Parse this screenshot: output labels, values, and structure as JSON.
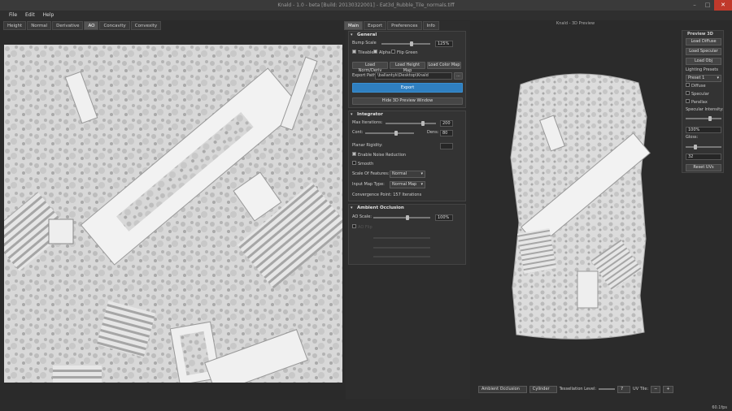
{
  "window": {
    "title": "Knald - 1.0 - beta [Build: 20130322001] - Eat3d_Rubble_Tile_normals.tiff",
    "buttons": [
      "–",
      "□",
      "✕"
    ]
  },
  "menu": [
    "File",
    "Edit",
    "Help"
  ],
  "view_tabs": [
    {
      "label": "Height",
      "active": false
    },
    {
      "label": "Normal",
      "active": false
    },
    {
      "label": "Derivative",
      "active": false
    },
    {
      "label": "AO",
      "active": true
    },
    {
      "label": "Concavity",
      "active": false
    },
    {
      "label": "Convexity",
      "active": false
    }
  ],
  "panel_tabs": [
    {
      "label": "Main",
      "active": true
    },
    {
      "label": "Export",
      "active": false
    },
    {
      "label": "Preferences",
      "active": false
    },
    {
      "label": "Info",
      "active": false
    }
  ],
  "general": {
    "title": "General",
    "bump_scale_label": "Bump Scale",
    "bump_scale_value": "125%",
    "bump_scale_level": 0.62,
    "tileable": "Tileable",
    "alpha": "Alpha",
    "flip_green": "Flip Green",
    "load_norm": "Load Norm/Deriv",
    "load_height": "Load Height Map",
    "load_color": "Load Color Map",
    "export_path_label": "Export Path:",
    "export_path": "\\ballantyk\\Desktop\\Knald Demo\\export",
    "browse": "...",
    "export": "Export",
    "hide_preview": "Hide 3D Preview Window"
  },
  "integrator": {
    "title": "Integrator",
    "max_iter_label": "Max Iterations:",
    "max_iter_value": "200",
    "max_iter_level": 0.75,
    "cont_label": "Cont:",
    "cont_level": 0.65,
    "dens_label": "Dens:",
    "dens_value": "80",
    "planar_label": "Planar Rigidity:",
    "noise": "Enable Noise Reduction",
    "smooth": "Smooth",
    "scale_label": "Scale Of Features:",
    "scale_value": "Normal",
    "input_label": "Input Map Type:",
    "input_value": "Normal Map",
    "convergence": "Convergence Point:  157 Iterations"
  },
  "ao": {
    "title": "Ambient Occlusion",
    "scale_label": "AO Scale:",
    "scale_value": "100%",
    "scale_level": 0.6,
    "flip": "AO Flip"
  },
  "preview": {
    "title": "Knald - 3D Preview",
    "panel_title": "Preview 3D",
    "load_diffuse": "Load Diffuse",
    "load_specular": "Load Specular",
    "load_obj": "Load Obj",
    "lighting_label": "Lighting Presets",
    "preset": "Preset 1",
    "diffuse": "Diffuse",
    "specular": "Specular",
    "parallax": "Parallax",
    "spec_intensity": "Specular Intensity:",
    "spec_value": "100%",
    "gloss_label": "Gloss:",
    "gloss_value": "32",
    "reset": "Reset UVs"
  },
  "bottom": {
    "mode": "Ambient Occlusion",
    "mesh": "Cylinder",
    "tess_label": "Tessellation Level:",
    "tess_value": "7",
    "uv_label": "UV Tile:",
    "fps": "60.1fps"
  },
  "colors": {
    "accent": "#2f7fc0",
    "close": "#c0392b",
    "bg": "#2b2b2b"
  }
}
